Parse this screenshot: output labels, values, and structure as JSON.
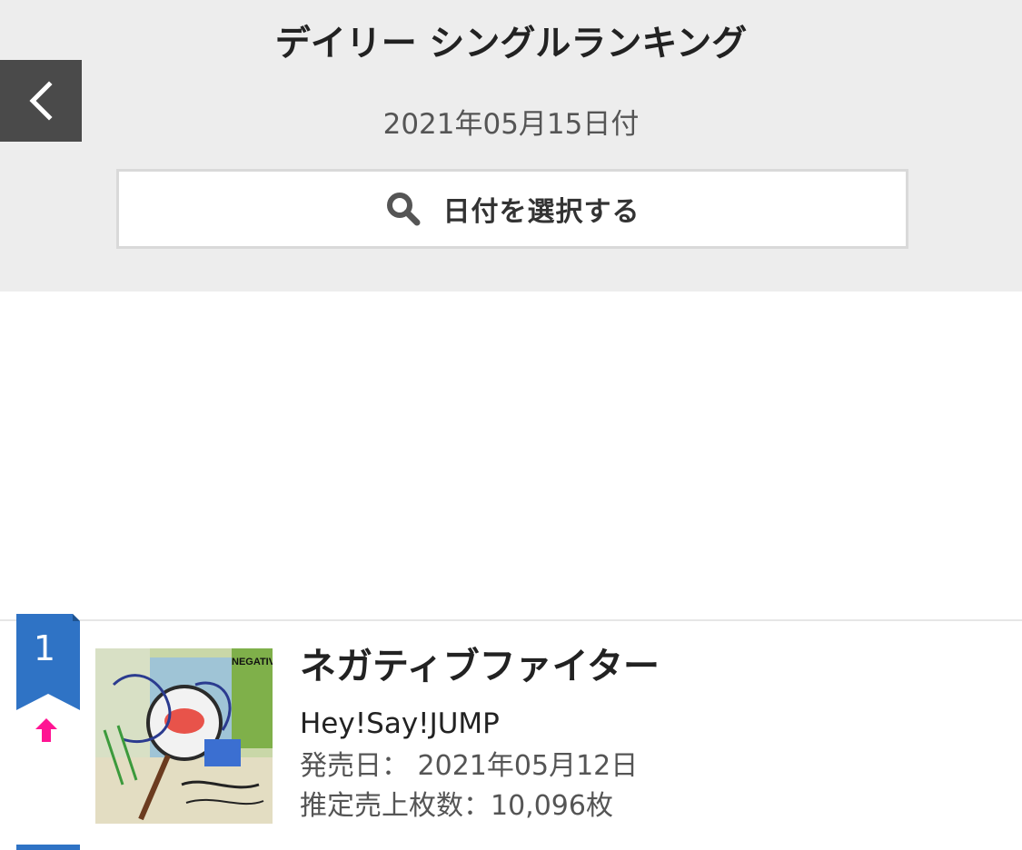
{
  "header": {
    "title": "デイリー シングルランキング",
    "date": "2021年05月15日付",
    "date_select_label": "日付を選択する",
    "back_icon": "chevron-left-icon",
    "search_icon": "search-icon"
  },
  "ranking": {
    "items": [
      {
        "rank": "1",
        "trend": "up",
        "title": "ネガティブファイター",
        "artist": "Hey!Say!JUMP",
        "release_label": "発売日：",
        "release_date": "2021年05月12日",
        "sales_label": "推定売上枚数：",
        "sales": "10,096枚",
        "cover_text": "NEGATIVE FIGHTER"
      }
    ]
  },
  "colors": {
    "header_bg": "#ededed",
    "back_button_bg": "#4a4a4a",
    "rank_ribbon": "#2f73c5",
    "trend_up": "#ff1493",
    "text_primary": "#222222",
    "text_secondary": "#555555"
  }
}
